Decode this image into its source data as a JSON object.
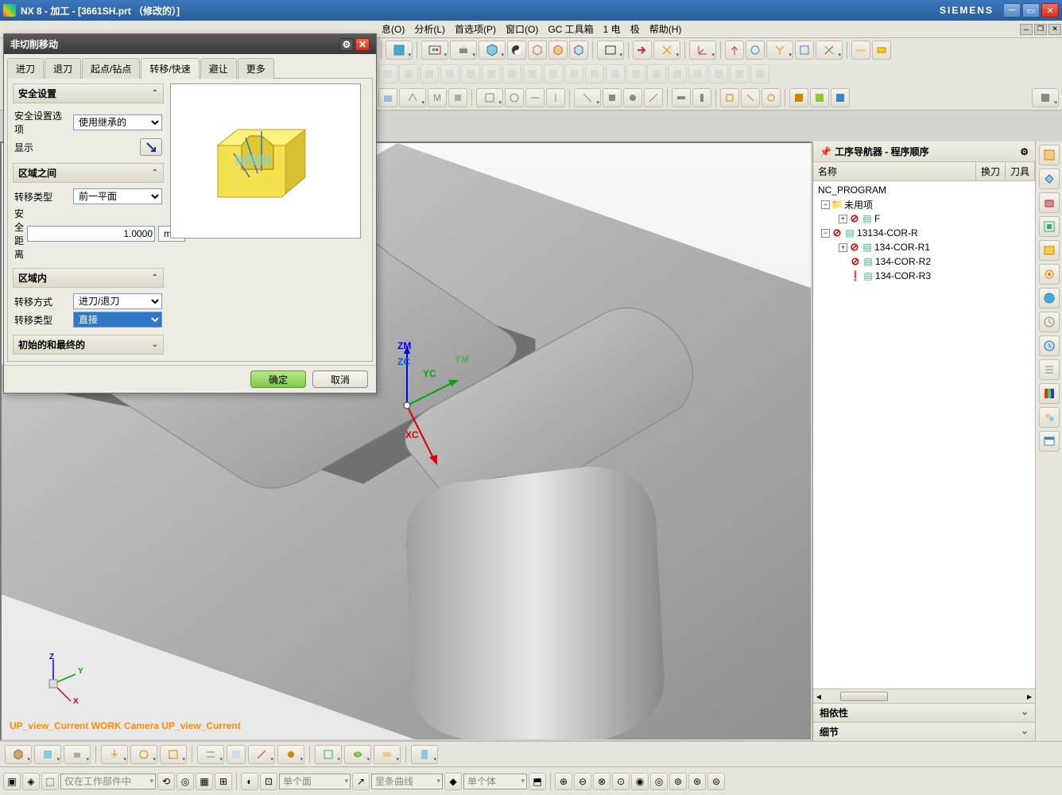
{
  "titlebar": {
    "title": "NX 8 - 加工 - [3661SH.prt （修改的）]",
    "brand": "SIEMENS"
  },
  "menu": {
    "items": [
      "息(O)",
      "分析(L)",
      "首选项(P)",
      "窗口(O)",
      "GC 工具箱",
      "1 电",
      "极",
      "帮助(H)"
    ]
  },
  "dialog": {
    "title": "非切削移动",
    "tabs": [
      "进刀",
      "退刀",
      "起点/钻点",
      "转移/快速",
      "避让",
      "更多"
    ],
    "active_tab": 3,
    "safety": {
      "head": "安全设置",
      "opt_label": "安全设置选项",
      "opt_value": "使用继承的",
      "show_label": "显示"
    },
    "between": {
      "head": "区域之间",
      "type_label": "转移类型",
      "type_value": "前一平面",
      "dist_label": "安全距离",
      "dist_value": "1.0000",
      "dist_unit": "mm"
    },
    "within": {
      "head": "区域内",
      "mode_label": "转移方式",
      "mode_value": "进刀/退刀",
      "type_label": "转移类型",
      "type_value": "直接"
    },
    "initfinal": {
      "head": "初始的和最终的"
    },
    "ok": "确定",
    "cancel": "取消"
  },
  "navigator": {
    "title": "工序导航器 - 程序顺序",
    "cols": {
      "name": "名称",
      "c1": "换刀",
      "c2": "刀具"
    },
    "root": "NC_PROGRAM",
    "unused": "未用项",
    "items": [
      "F",
      "13134-COR-R",
      "134-COR-R1",
      "134-COR-R2",
      "134-COR-R3"
    ],
    "dep": "相依性",
    "detail": "细节"
  },
  "viewport": {
    "label": "UP_view_Current WORK Camera UP_view_Current",
    "axes": {
      "zm": "ZM",
      "zc": "ZC",
      "yc": "YC",
      "ym": "YM",
      "xc": "XC"
    },
    "mini_axes": {
      "z": "Z",
      "y": "Y",
      "x": "X"
    }
  },
  "status": {
    "combo1": "仅在工作部件中",
    "combo2": "单个面",
    "combo3": "里条曲线",
    "combo4": "单个体"
  }
}
